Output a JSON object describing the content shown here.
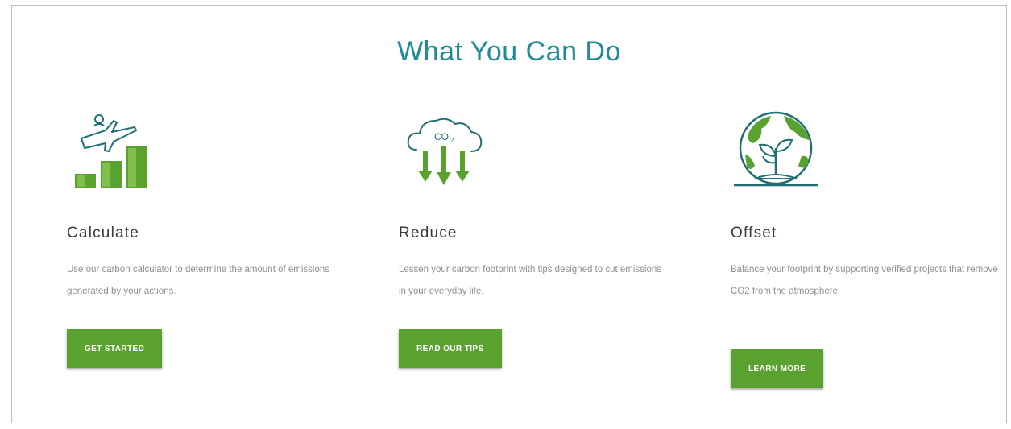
{
  "section": {
    "title": "What You Can Do"
  },
  "cards": [
    {
      "title": "Calculate",
      "description": "Use our carbon calculator to determine the amount of emissions generated by your actions.",
      "button_label": "GET STARTED",
      "icon": "chart-bars-icon"
    },
    {
      "title": "Reduce",
      "description": "Lessen your carbon footprint with tips designed to cut emissions in your everyday life.",
      "button_label": "READ OUR TIPS",
      "icon": "co2-cloud-icon"
    },
    {
      "title": "Offset",
      "description": "Balance your footprint by supporting verified projects that remove CO2 from the atmosphere.",
      "button_label": "LEARN MORE",
      "icon": "globe-plant-icon"
    }
  ],
  "colors": {
    "title": "#1f8b99",
    "accent": "#5aa22f",
    "icon_stroke": "#1f6f73",
    "text": "#3a3a3a",
    "muted": "#8f8f8f"
  }
}
